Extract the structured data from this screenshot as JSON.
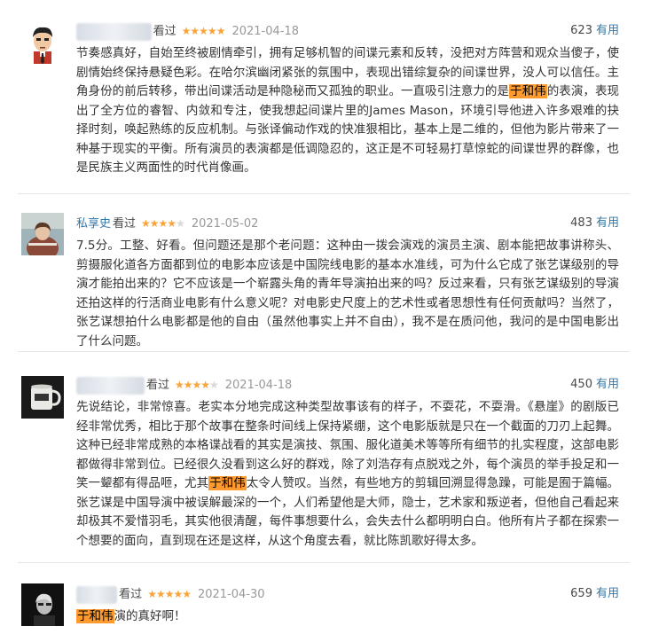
{
  "reviews": [
    {
      "status": "看过",
      "stars": 5,
      "date": "2021-04-18",
      "votes": "623",
      "useful_label": "有用",
      "text_before": "节奏感真好，自始至终被剧情牵引，拥有足够机智的间谍元素和反转，没把对方阵营和观众当傻子，使剧情始终保持悬疑色彩。在哈尔滨幽闭紧张的氛围中，表现出错综复杂的间谍世界，没人可以信任。主角身份的前后转移，带出间谍活动是种隐秘而又孤独的职业。一直吸引注意力的是",
      "highlight": "于和伟",
      "text_after": "的表演，表现出了全方位的睿智、内敛和专注，使我想起间谍片里的James Mason，环境引导他进入许多艰难的抉择时刻，唤起熟练的反应机制。与张译偏动作戏的快准狠相比，基本上是二维的，但他为影片带来了一种基于现实的平衡。所有演员的表演都是低调隐忍的，这正是不可轻易打草惊蛇的间谍世界的群像，也是民族主义两面性的时代肖像画。"
    },
    {
      "username": "私享史",
      "status": "看过",
      "stars": 4,
      "date": "2021-05-02",
      "votes": "483",
      "useful_label": "有用",
      "text_before": "7.5分。工整、好看。但问题还是那个老问题：这种由一拨会演戏的演员主演、剧本能把故事讲称头、剪摄服化道各方面都到位的电影本应该是中国院线电影的基本水准线，可为什么它成了张艺谋级别的导演才能拍出来的？它不应该是一个崭露头角的青年导演拍出来的吗？反过来看，只有张艺谋级别的导演还拍这样的行活商业电影有什么意义呢？对电影史尺度上的艺术性或者思想性有任何贡献吗？当然了，张艺谋想拍什么电影都是他的自由（虽然他事实上并不自由），我不是在质问他，我问的是中国电影出了什么问题。",
      "highlight": "",
      "text_after": ""
    },
    {
      "status": "看过",
      "stars": 4,
      "date": "2021-04-18",
      "votes": "450",
      "useful_label": "有用",
      "text_before": "先说结论，非常惊喜。老实本分地完成这种类型故事该有的样子，不耍花，不耍滑。《悬崖》的剧版已经非常优秀，相比于那个故事在整条时间线上保持紧绷，这个电影版就是只在一个截面的刀刃上起舞。这种已经非常成熟的本格谍战看的其实是演技、氛围、服化道美术等等所有细节的扎实程度，这部电影都做得非常到位。已经很久没看到这么好的群戏，除了刘浩存有点脱戏之外，每个演员的举手投足和一笑一颦都有得品咂，尤其",
      "highlight": "于和伟",
      "text_after": "太令人赞叹。当然，有些地方的剪辑回溯显得急躁，可能是囿于篇幅。张艺谋是中国导演中被误解最深的一个，人们希望他是大师，隐士，艺术家和叛逆者，但他自己看起来却极其不爱惜羽毛，其实他很清醒，每件事想要什么，会失去什么都明明白白。他所有片子都在探索一个想要的面向，直到现在还是这样，从这个角度去看，就比陈凯歌好得太多。"
    },
    {
      "status": "看过",
      "stars": 5,
      "date": "2021-04-30",
      "votes": "659",
      "useful_label": "有用",
      "text_before": "",
      "highlight": "于和伟",
      "text_after": "演的真好啊！"
    }
  ]
}
